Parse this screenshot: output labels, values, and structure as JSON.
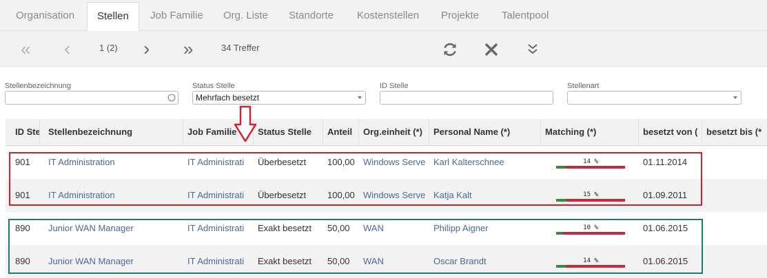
{
  "tabs": [
    "Organisation",
    "Stellen",
    "Job Familie",
    "Org. Liste",
    "Standorte",
    "Kostenstellen",
    "Projekte",
    "Talentpool"
  ],
  "toolbar": {
    "page_info": "1 (2)",
    "hits": "34 Treffer",
    "first_icon": "«",
    "prev_icon": "‹",
    "next_icon": "›",
    "last_icon": "»"
  },
  "filters": {
    "stellenbezeichnung": {
      "label": "Stellenbezeichnung",
      "value": ""
    },
    "status_stelle": {
      "label": "Status Stelle",
      "value": "Mehrfach besetzt"
    },
    "id_stelle": {
      "label": "ID Stelle",
      "value": ""
    },
    "stellenart": {
      "label": "Stellenart",
      "value": ""
    }
  },
  "columns": [
    "ID Ste",
    "Stellenbezeichnung",
    "Job Familie",
    "Status Stelle",
    "Anteil",
    "Org.einheit (*)",
    "Personal Name (*)",
    "Matching (*)",
    "besetzt von (",
    "besetzt bis (*"
  ],
  "rows": [
    {
      "id": "901",
      "title": "IT Administration",
      "family": "IT Administrati",
      "status": "Überbesetzt",
      "share": "100,00",
      "unit": "Windows Serve",
      "name": "Karl Kalterschnee",
      "matching": "14 %",
      "matching_value": 14,
      "from": "01.11.2014",
      "to": ""
    },
    {
      "id": "901",
      "title": "IT Administration",
      "family": "IT Administrati",
      "status": "Überbesetzt",
      "share": "100,00",
      "unit": "Windows Serve",
      "name": "Katja Kalt",
      "matching": "15 %",
      "matching_value": 15,
      "from": "01.09.2011",
      "to": ""
    },
    {
      "id": "890",
      "title": "Junior WAN Manager",
      "family": "IT Administrati",
      "status": "Exakt besetzt",
      "share": "50,00",
      "unit": "WAN",
      "name": "Philipp Aigner",
      "matching": "10 %",
      "matching_value": 10,
      "from": "01.06.2015",
      "to": ""
    },
    {
      "id": "890",
      "title": "Junior WAN Manager",
      "family": "IT Administrati",
      "status": "Exakt besetzt",
      "share": "50,00",
      "unit": "WAN",
      "name": "Oscar Brandt",
      "matching": "14 %",
      "matching_value": 14,
      "from": "01.06.2015",
      "to": ""
    }
  ],
  "colors": {
    "red_box": "#d41f2a",
    "teal_box": "#1a7a6e",
    "arrow": "#d41f2a",
    "link": "#4a6a9c",
    "bar_green": "#3a8a3a",
    "bar_red": "#c8283c"
  }
}
